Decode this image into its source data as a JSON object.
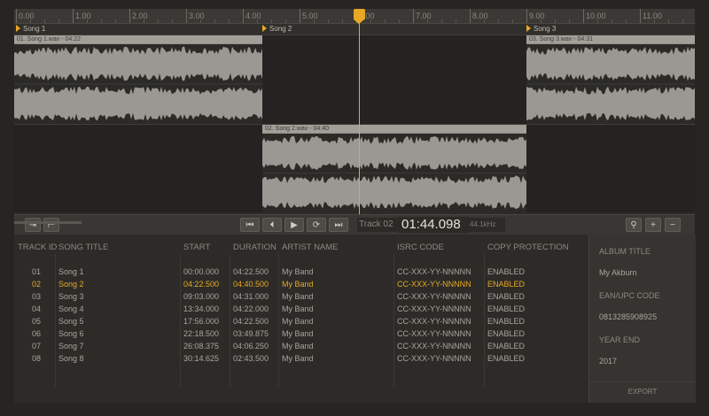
{
  "ruler": {
    "ticks": [
      "0.00",
      "1.00",
      "2.00",
      "3.00",
      "4.00",
      "5.00",
      "6.00",
      "7.00",
      "8.00",
      "9.00",
      "10.00",
      "11.00"
    ]
  },
  "markers": [
    "Song 1",
    "Song 2",
    "Song 3"
  ],
  "clips": {
    "c1": "01. Song 1.wav - 04:22",
    "c2": "02. Song 2.wav - 04:40",
    "c3": "03. Song 3.wav - 04:31"
  },
  "transport": {
    "track": "Track 02",
    "timecode": "01:44.098",
    "sample_rate": "44.1kHz",
    "icons": [
      "skip-back-icon",
      "prev-icon",
      "play-icon",
      "loop-icon",
      "skip-forward-icon"
    ]
  },
  "table": {
    "headers": [
      "TRACK ID",
      "SONG TITLE",
      "START",
      "DURATION",
      "ARTIST NAME",
      "ISRC CODE",
      "COPY PROTECTION"
    ],
    "rows": [
      [
        "01",
        "Song 1",
        "00:00.000",
        "04:22.500",
        "My Band",
        "CC-XXX-YY-NNNNN",
        "ENABLED"
      ],
      [
        "02",
        "Song 2",
        "04:22.500",
        "04:40.500",
        "My Band",
        "CC-XXX-YY-NNNNN",
        "ENABLED"
      ],
      [
        "03",
        "Song 3",
        "09:03.000",
        "04:31.000",
        "My Band",
        "CC-XXX-YY-NNNNN",
        "ENABLED"
      ],
      [
        "04",
        "Song 4",
        "13:34.000",
        "04:22.000",
        "My Band",
        "CC-XXX-YY-NNNNN",
        "ENABLED"
      ],
      [
        "05",
        "Song 5",
        "17:56.000",
        "04:22.500",
        "My Band",
        "CC-XXX-YY-NNNNN",
        "ENABLED"
      ],
      [
        "06",
        "Song 6",
        "22:18.500",
        "03:49.875",
        "My Band",
        "CC-XXX-YY-NNNNN",
        "ENABLED"
      ],
      [
        "07",
        "Song 7",
        "26:08.375",
        "04:06.250",
        "My Band",
        "CC-XXX-YY-NNNNN",
        "ENABLED"
      ],
      [
        "08",
        "Song 8",
        "30:14.625",
        "02:43.500",
        "My Band",
        "CC-XXX-YY-NNNNN",
        "ENABLED"
      ]
    ],
    "active_row": 1
  },
  "side": {
    "album_title_label": "ALBUM TITLE",
    "album_title": "My Akburn",
    "ean_label": "EAN/UPC CODE",
    "ean": "0813285908925",
    "year_label": "YEAR END",
    "year": "2017",
    "export": "EXPORT"
  },
  "colors": {
    "accent": "#e8a825",
    "wave": "#8f8d88",
    "bg": "#2c2b28"
  }
}
